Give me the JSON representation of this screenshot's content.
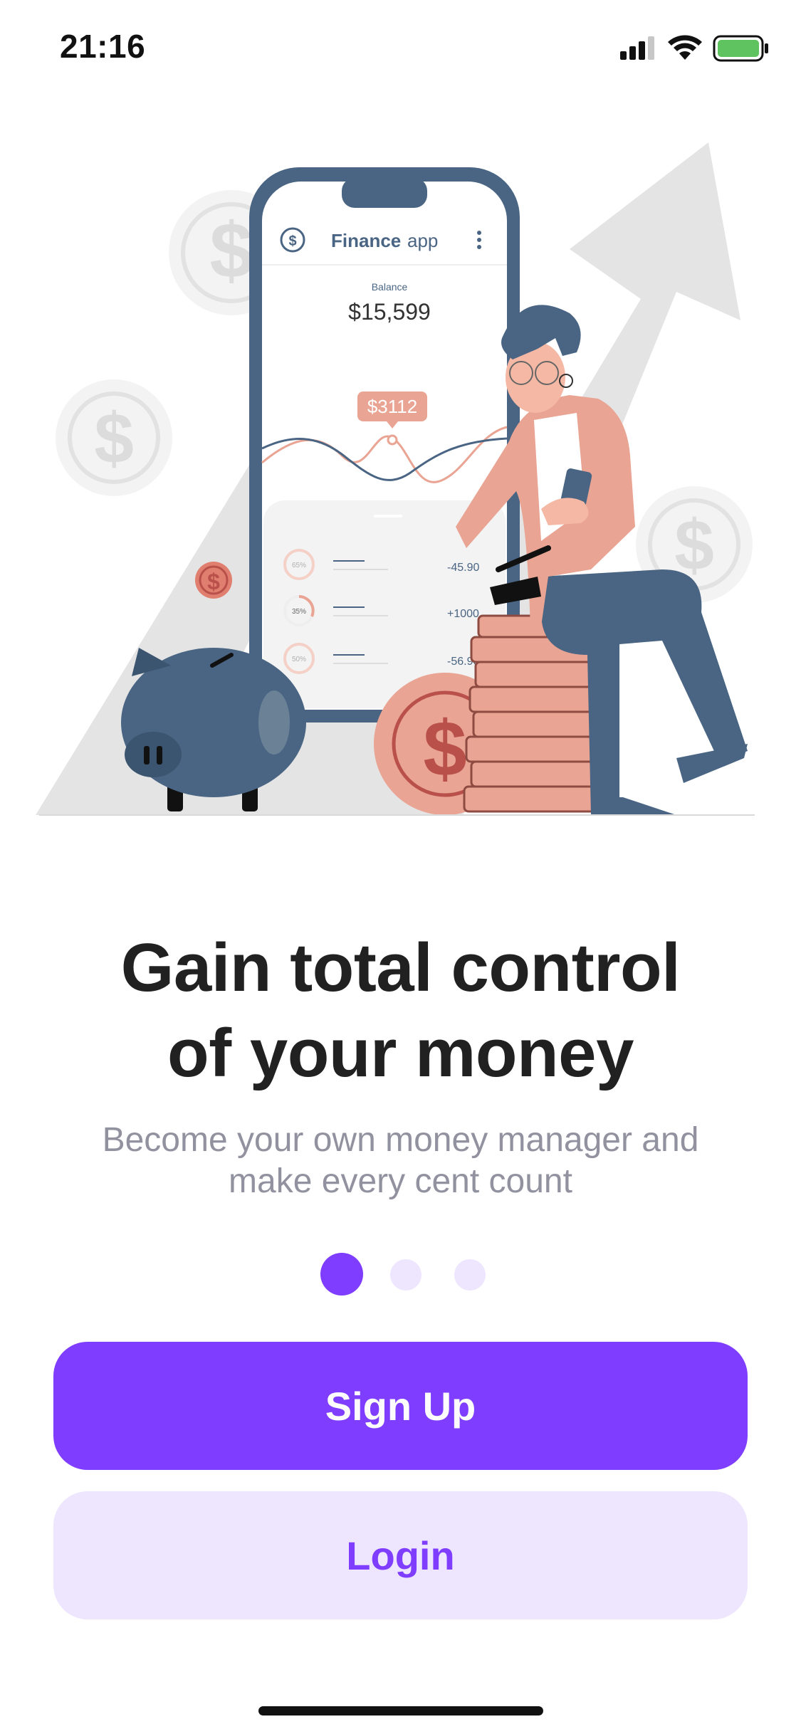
{
  "status_bar": {
    "time": "21:16",
    "icons": [
      "cellular-signal-icon",
      "wifi-icon",
      "battery-icon"
    ],
    "battery_color": "#5fc45f"
  },
  "illustration": {
    "phone_title_bold": "Finance",
    "phone_title_light": "app",
    "balance_label": "Balance",
    "balance_value": "$15,599",
    "chart_tooltip": "$3112",
    "transactions": [
      {
        "percent": "65%",
        "amount": "-45.90"
      },
      {
        "percent": "35%",
        "amount": "+1000"
      },
      {
        "percent": "50%",
        "amount": "-56.90"
      }
    ]
  },
  "onboarding": {
    "headline_line1": "Gain total control",
    "headline_line2": "of your money",
    "subtext_line1": "Become your own money manager and",
    "subtext_line2": "make every cent count",
    "current_page": 1,
    "page_count": 3
  },
  "buttons": {
    "signup_label": "Sign Up",
    "login_label": "Login"
  },
  "colors": {
    "primary": "#7f3dff",
    "primary_light": "#eee5ff",
    "headline": "#212121",
    "subtext": "#91919f",
    "illustration_dark": "#4a6583",
    "illustration_accent": "#e9a493"
  }
}
